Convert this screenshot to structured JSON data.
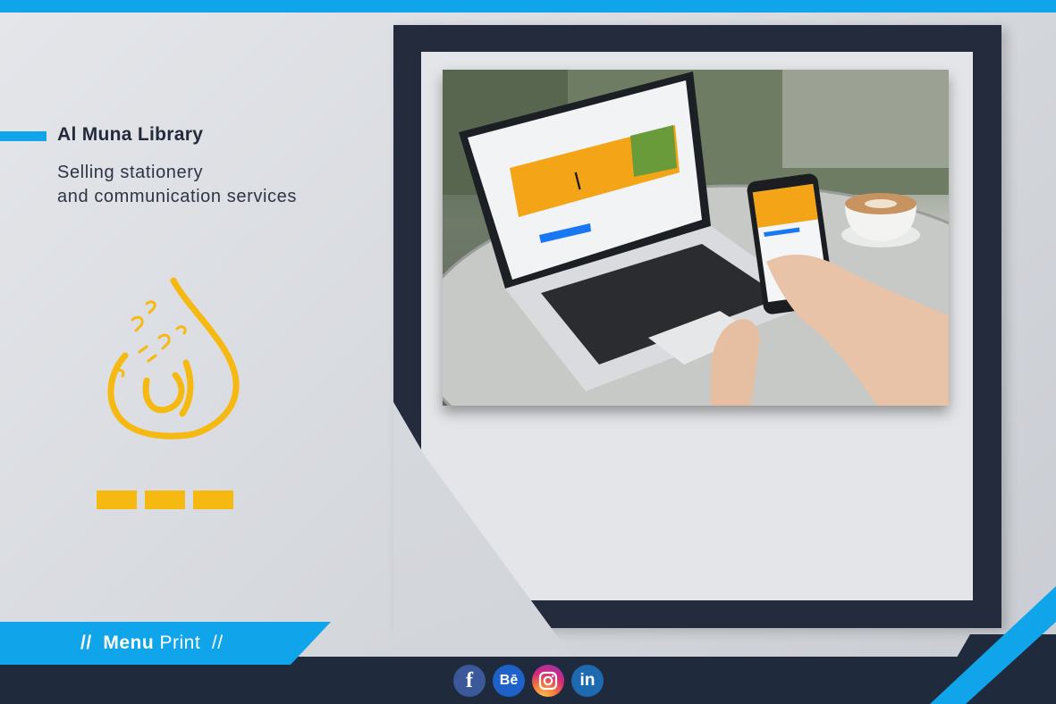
{
  "brand": {
    "title": "Al Muna Library",
    "tagline_line1": "Selling stationery",
    "tagline_line2": "and communication services"
  },
  "menu": {
    "prefix": "//",
    "bold": "Menu",
    "light": "Print",
    "suffix": "//"
  },
  "social": {
    "facebook_label": "f",
    "behance_label": "Bē",
    "linkedin_label": "in"
  },
  "colors": {
    "accent_blue": "#10a5ea",
    "navy": "#232b3d",
    "brand_yellow": "#f6b912"
  },
  "icons": [
    "facebook-icon",
    "behance-icon",
    "instagram-icon",
    "linkedin-icon",
    "arabic-logo"
  ]
}
